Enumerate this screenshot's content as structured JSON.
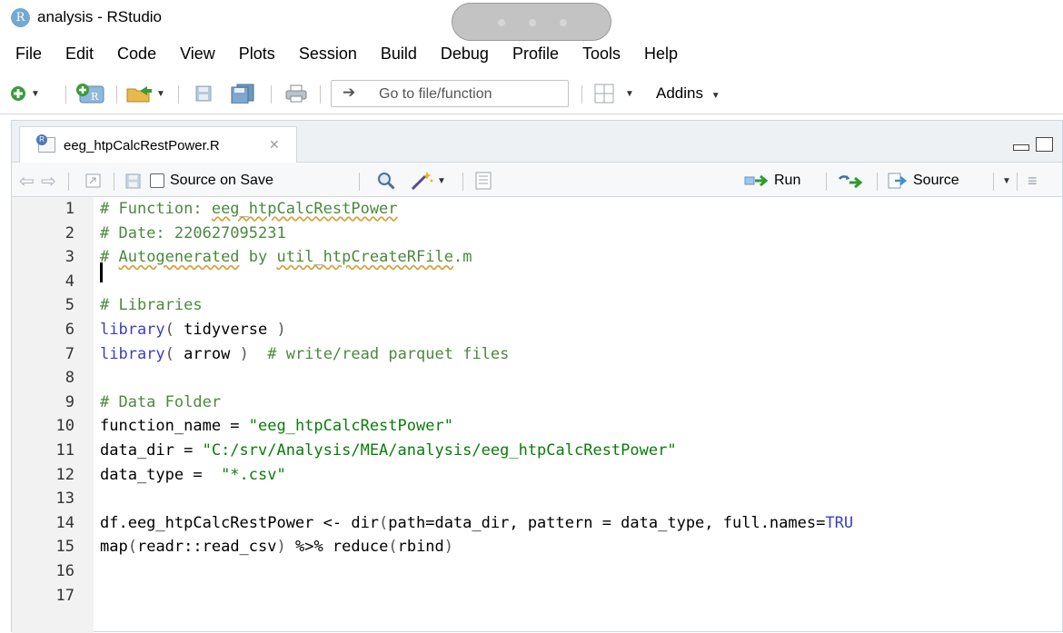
{
  "window": {
    "title": "analysis - RStudio",
    "logo": "R"
  },
  "menu": [
    "File",
    "Edit",
    "Code",
    "View",
    "Plots",
    "Session",
    "Build",
    "Debug",
    "Profile",
    "Tools",
    "Help"
  ],
  "toolbar": {
    "goto_placeholder": "Go to file/function",
    "addins_label": "Addins"
  },
  "editor": {
    "tab_name": "eeg_htpCalcRestPower.R",
    "source_on_save_label": "Source on Save",
    "run_label": "Run",
    "source_label": "Source",
    "lines": [
      {
        "n": "1",
        "segs": [
          {
            "t": "# Function: ",
            "c": "cm"
          },
          {
            "t": "eeg_htpCalcRestPower",
            "c": "cm squig"
          }
        ]
      },
      {
        "n": "2",
        "segs": [
          {
            "t": "# Date: 220627095231",
            "c": "cm"
          }
        ]
      },
      {
        "n": "3",
        "segs": [
          {
            "t": "# ",
            "c": "cm"
          },
          {
            "t": "Autogenerated",
            "c": "cm squig"
          },
          {
            "t": " by ",
            "c": "cm"
          },
          {
            "t": "util_htpCreateRFile",
            "c": "cm squig"
          },
          {
            "t": ".m",
            "c": "cm"
          }
        ]
      },
      {
        "n": "4",
        "segs": []
      },
      {
        "n": "5",
        "segs": [
          {
            "t": "# Libraries",
            "c": "cm"
          }
        ]
      },
      {
        "n": "6",
        "segs": [
          {
            "t": "library",
            "c": "kw"
          },
          {
            "t": "( ",
            "c": "pn"
          },
          {
            "t": "tidyverse",
            "c": ""
          },
          {
            "t": " )",
            "c": "pn"
          }
        ]
      },
      {
        "n": "7",
        "segs": [
          {
            "t": "library",
            "c": "kw"
          },
          {
            "t": "( ",
            "c": "pn"
          },
          {
            "t": "arrow",
            "c": ""
          },
          {
            "t": " )",
            "c": "pn"
          },
          {
            "t": "  # write/read parquet files",
            "c": "cm"
          }
        ]
      },
      {
        "n": "8",
        "segs": []
      },
      {
        "n": "9",
        "segs": [
          {
            "t": "# Data Folder",
            "c": "cm"
          }
        ]
      },
      {
        "n": "10",
        "segs": [
          {
            "t": "function_name = ",
            "c": ""
          },
          {
            "t": "\"eeg_htpCalcRestPower\"",
            "c": "st"
          }
        ]
      },
      {
        "n": "11",
        "segs": [
          {
            "t": "data_dir = ",
            "c": ""
          },
          {
            "t": "\"C:/srv/Analysis/MEA/analysis/eeg_htpCalcRestPower\"",
            "c": "st"
          }
        ]
      },
      {
        "n": "12",
        "segs": [
          {
            "t": "data_type =  ",
            "c": ""
          },
          {
            "t": "\"*.csv\"",
            "c": "st"
          }
        ]
      },
      {
        "n": "13",
        "segs": []
      },
      {
        "n": "14",
        "segs": [
          {
            "t": "df.eeg_htpCalcRestPower <- dir",
            "c": ""
          },
          {
            "t": "(",
            "c": "pn"
          },
          {
            "t": "path=data_dir, pattern = data_type, full.names=",
            "c": ""
          },
          {
            "t": "TRU",
            "c": "kw"
          }
        ]
      },
      {
        "n": "15",
        "segs": [
          {
            "t": "map",
            "c": ""
          },
          {
            "t": "(",
            "c": "pn"
          },
          {
            "t": "readr::read_csv",
            "c": ""
          },
          {
            "t": ")",
            "c": "pn"
          },
          {
            "t": " %>% reduce",
            "c": ""
          },
          {
            "t": "(",
            "c": "pn"
          },
          {
            "t": "rbind",
            "c": ""
          },
          {
            "t": ")",
            "c": "pn"
          }
        ]
      },
      {
        "n": "16",
        "segs": []
      },
      {
        "n": "17",
        "segs": []
      }
    ]
  }
}
